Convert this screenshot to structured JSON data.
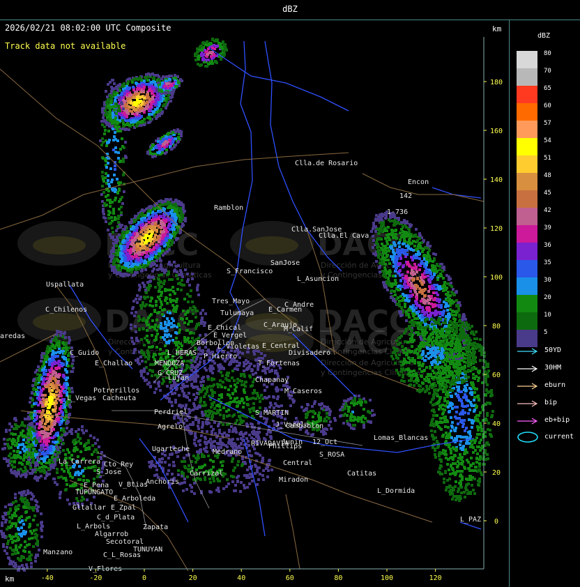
{
  "header": {
    "title": "dBZ"
  },
  "map": {
    "timestamp": "2026/02/21 08:02:00 UTC Composite",
    "track_note": "Track data not available",
    "unit_top": "km",
    "unit_bottom": "km",
    "x_ticks": [
      "-40",
      "-20",
      "0",
      "20",
      "40",
      "60",
      "80",
      "100",
      "120"
    ],
    "y_ticks": [
      "180",
      "160",
      "140",
      "120",
      "100",
      "80",
      "60",
      "40",
      "20",
      "0"
    ],
    "watermark": "DACC",
    "watermark_sub1": "Dirección de Agricultura",
    "watermark_sub2": "y Contingencias Climáticas",
    "places": [
      "Clla.de Rosario",
      "Encon",
      "142",
      "1-736",
      "Ramblon",
      "Clla.SanJose",
      "Clla.El Cava",
      "Uspallata",
      "S_Francisco",
      "SanJose",
      "L_Asuncion",
      "C_Chilenos",
      "Tres_Mayo",
      "C_Andre",
      "Tulumaya",
      "E_Carmen",
      "E_Chical",
      "C_Araujo",
      "M_Calif",
      "E_Vergel",
      "Borbollon",
      "L_Violetas",
      "E_Central",
      "Divisadero",
      "C_Guido",
      "L_HERAS",
      "P_Hierro",
      "E_Challao",
      "MENDOZA",
      "T_Fortenas",
      "G_CRUZ",
      "Lujan",
      "Chapanay",
      "M_Caseros",
      "Potrerillos",
      "L_Vegas",
      "Cacheuta",
      "Perdriel",
      "Agrelo",
      "S_MARTIN",
      "J_Varela",
      "Cambiolon",
      "Ugarteche",
      "RIVADAVIA",
      "Junin",
      "12_Oct",
      "Phillips",
      "S_ROSA",
      "Lomas_Blancas",
      "La_Carrera",
      "Cto_Rey",
      "S_Jose",
      "Anchoris",
      "Carrizal",
      "Catitas",
      "E_Pena",
      "V_Btias",
      "TUPUNGATO",
      "Miradon",
      "Central",
      "L_Dormida",
      "E_Arboleda",
      "Gltallar",
      "E_Zpal",
      "C_d_Plata",
      "L_Arbols",
      "Zapata",
      "Algarrob",
      "Secotoral",
      "TUNUYAN",
      "Manzano",
      "C_L_Rosas",
      "V_Flores",
      "L_PAZ",
      "aredas",
      "Medrano"
    ]
  },
  "legend": {
    "unit": "dBZ",
    "bins": [
      {
        "label": "80",
        "color": "#d8d8d8"
      },
      {
        "label": "70",
        "color": "#b8b8b8"
      },
      {
        "label": "65",
        "color": "#ff3a20"
      },
      {
        "label": "60",
        "color": "#ff6a00"
      },
      {
        "label": "57",
        "color": "#ff9a5a"
      },
      {
        "label": "54",
        "color": "#ffff00"
      },
      {
        "label": "51",
        "color": "#ffcc30"
      },
      {
        "label": "48",
        "color": "#d89040"
      },
      {
        "label": "45",
        "color": "#c87040"
      },
      {
        "label": "42",
        "color": "#c06090"
      },
      {
        "label": "39",
        "color": "#cc1a9a"
      },
      {
        "label": "36",
        "color": "#7a22d0"
      },
      {
        "label": "35",
        "color": "#2a58e8"
      },
      {
        "label": "30",
        "color": "#1a90e8"
      },
      {
        "label": "20",
        "color": "#128a12"
      },
      {
        "label": "10",
        "color": "#0e6a0e"
      },
      {
        "label": "5",
        "color": "#4a3a8a"
      }
    ],
    "tracks": [
      {
        "label": "50YD",
        "color": "#40e0ff"
      },
      {
        "label": "30HM",
        "color": "#ffffff"
      },
      {
        "label": "eburn",
        "color": "#ffd090"
      },
      {
        "label": "bip",
        "color": "#ffc0c0"
      },
      {
        "label": "eb+bip",
        "color": "#ff60ff"
      }
    ],
    "current": {
      "label": "current",
      "color": "#20e0ff"
    }
  }
}
